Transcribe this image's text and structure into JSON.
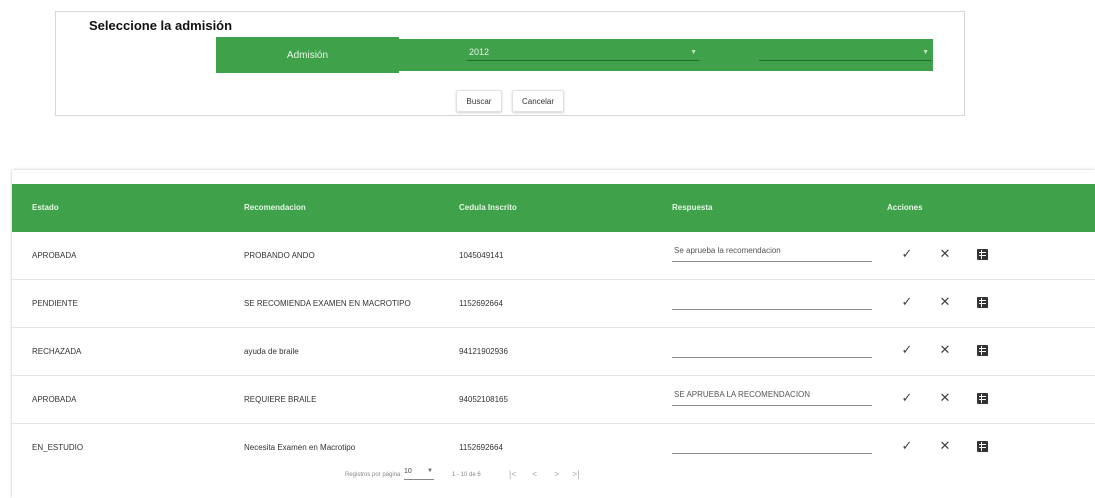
{
  "filter": {
    "title": "Seleccione la admisión",
    "admission_label": "Admisión",
    "admission_value": "2012",
    "second_select_value": "",
    "search_button": "Buscar",
    "cancel_button": "Cancelar"
  },
  "table": {
    "headers": {
      "estado": "Estado",
      "recomendacion": "Recomendacion",
      "cedula": "Cedula Inscrito",
      "respuesta": "Respuesta",
      "acciones": "Acciones"
    },
    "rows": [
      {
        "estado": "APROBADA",
        "recomendacion": "PROBANDO ANDO",
        "cedula": "1045049141",
        "respuesta": "Se aprueba la recomendacion"
      },
      {
        "estado": "PENDIENTE",
        "recomendacion": "SE RECOMIENDA EXAMEN EN MACROTIPO",
        "cedula": "1152692664",
        "respuesta": ""
      },
      {
        "estado": "RECHAZADA",
        "recomendacion": "ayuda de braile",
        "cedula": "94121902936",
        "respuesta": ""
      },
      {
        "estado": "APROBADA",
        "recomendacion": "REQUIERE BRAILE",
        "cedula": "94052108165",
        "respuesta": "SE APRUEBA LA RECOMENDACION"
      },
      {
        "estado": "EN_ESTUDIO",
        "recomendacion": "Necesita Examen en Macrotipo",
        "cedula": "1152692664",
        "respuesta": ""
      }
    ],
    "action_icons": [
      "check-icon",
      "close-icon",
      "detail-icon"
    ]
  },
  "paginator": {
    "rows_per_page_label": "Registros por página:",
    "rows_per_page_value": "10",
    "range_label": "1 - 10 de 6"
  },
  "colors": {
    "accent_green": "#3fa14a",
    "text": "#333333"
  }
}
